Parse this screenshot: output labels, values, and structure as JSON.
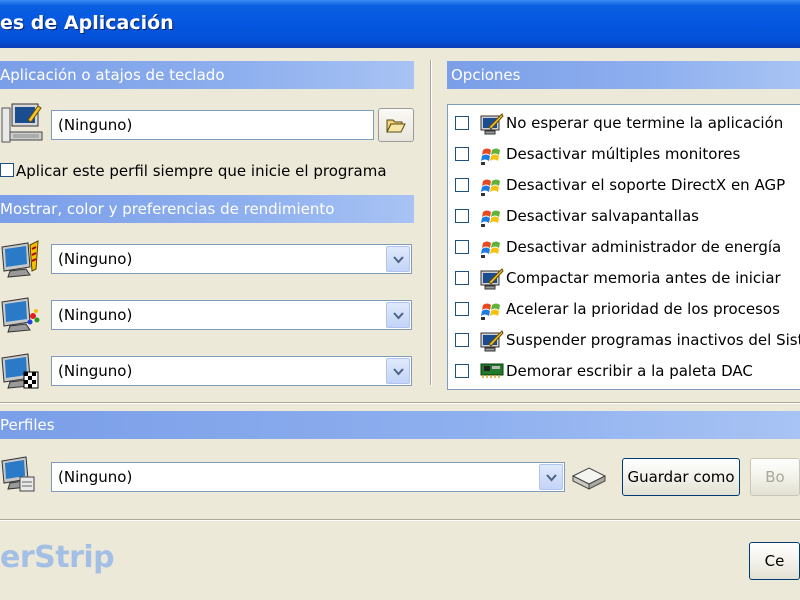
{
  "window": {
    "title": "es de Aplicación"
  },
  "sections": {
    "app": "Aplicación o atajos de teclado",
    "display": "Mostrar, color y preferencias de rendimiento",
    "options": "Opciones",
    "profiles": "Perfiles"
  },
  "app_field": {
    "value": "(Ninguno)"
  },
  "always_apply": {
    "label": "Aplicar este perfil siempre que inicie el programa",
    "checked": false
  },
  "display_combos": [
    {
      "value": "(Ninguno)"
    },
    {
      "value": "(Ninguno)"
    },
    {
      "value": "(Ninguno)"
    }
  ],
  "options": [
    {
      "label": "No esperar que termine la aplicación",
      "icon": "monitor-pencil-icon"
    },
    {
      "label": "Desactivar múltiples monitores",
      "icon": "windows-flag-icon"
    },
    {
      "label": "Desactivar el soporte DirectX en AGP",
      "icon": "windows-flag-icon"
    },
    {
      "label": "Desactivar salvapantallas",
      "icon": "windows-flag-icon"
    },
    {
      "label": "Desactivar administrador de energía",
      "icon": "windows-flag-icon"
    },
    {
      "label": "Compactar memoria antes de iniciar",
      "icon": "monitor-pencil-icon"
    },
    {
      "label": "Acelerar la prioridad de los procesos",
      "icon": "windows-flag-icon"
    },
    {
      "label": "Suspender programas inactivos del Siste",
      "icon": "monitor-pencil-icon"
    },
    {
      "label": "Demorar escribir a la paleta DAC",
      "icon": "graphics-card-icon"
    }
  ],
  "profile_combo": {
    "value": "(Ninguno)"
  },
  "buttons": {
    "save_as": "Guardar como",
    "delete": "Bo",
    "close": "Ce"
  },
  "brand": "erStrip"
}
